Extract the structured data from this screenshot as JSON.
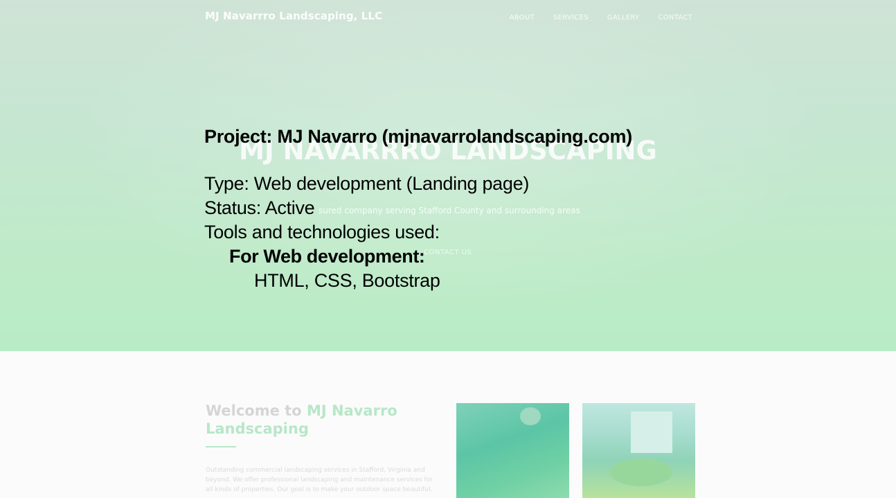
{
  "site": {
    "brand": "MJ Navarrro Landscaping, LLC",
    "nav": [
      "ABOUT",
      "SERVICES",
      "GALLERY",
      "CONTACT"
    ]
  },
  "hero": {
    "title": "MJ NAVARRRO LANDSCAPING",
    "tagline": "sured company serving Stafford County and surrounding areas",
    "cta": "CONTACT US"
  },
  "overlay": {
    "project": "Project: MJ Navarro (mjnavarrolandscaping.com)",
    "type": "Type: Web development (Landing page)",
    "status": "Status: Active",
    "tools_heading": "Tools and technologies used:",
    "web_dev_heading": "For Web development:",
    "web_dev_tools": "HTML, CSS, Bootstrap"
  },
  "welcome": {
    "heading_prefix": "Welcome to ",
    "heading_accent": "MJ Navarro Landscaping",
    "body": "Outstanding commercial landscaping services in Stafford, Virginia and beyond. We offer professional landscaping and maintenance services for all kinds of properties. Our goal is to make your outdoor space beautiful."
  },
  "colors": {
    "hero_green": "#bfeac9",
    "accent": "#b7e7c8"
  }
}
